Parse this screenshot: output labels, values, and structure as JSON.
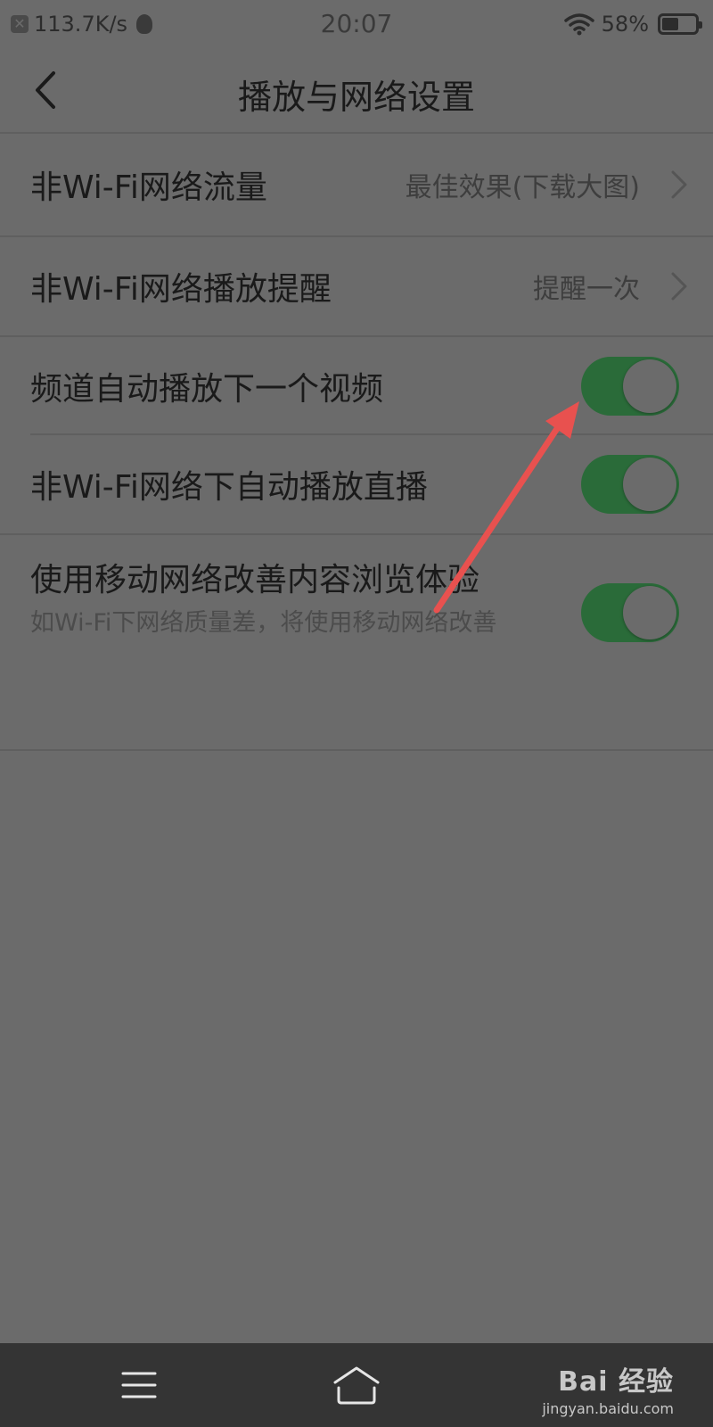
{
  "status_bar": {
    "net_speed": "113.7K/s",
    "time": "20:07",
    "battery": "58%"
  },
  "header": {
    "title": "播放与网络设置"
  },
  "settings": {
    "items": [
      {
        "label": "非Wi-Fi网络流量",
        "value": "最佳效果(下载大图)"
      },
      {
        "label": "非Wi-Fi网络播放提醒",
        "value": "提醒一次"
      },
      {
        "label": "频道自动播放下一个视频",
        "on": true
      },
      {
        "label": "非Wi-Fi网络下自动播放直播",
        "on": true
      },
      {
        "label": "使用移动网络改善内容浏览体验",
        "sublabel": "如Wi-Fi下网络质量差，将使用移动网络改善",
        "on": true
      }
    ]
  },
  "watermark": {
    "brand": "Bai 经验",
    "url": "jingyan.baidu.com"
  },
  "colors": {
    "toggle_on": "#2a6b39",
    "annotation_arrow": "#e8514f"
  }
}
